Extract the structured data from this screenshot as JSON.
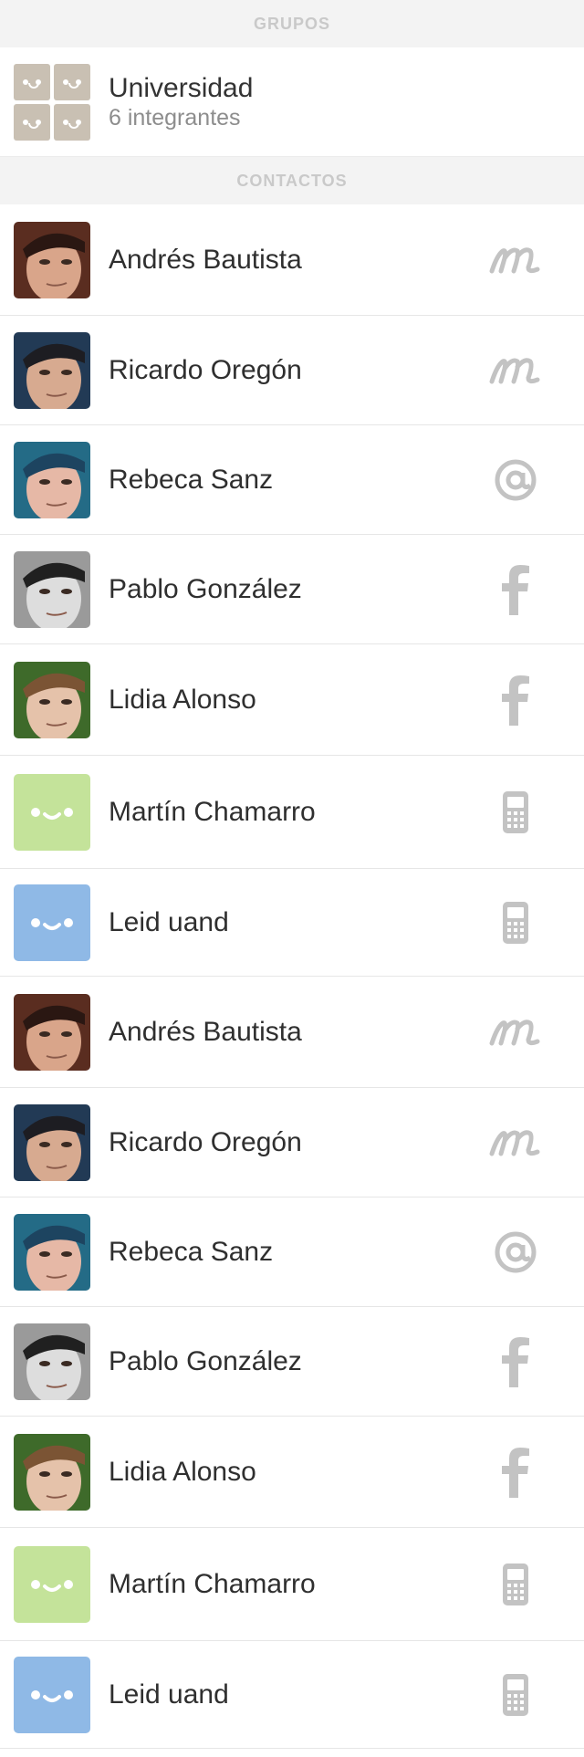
{
  "groups_header": "GRUPOS",
  "group": {
    "name": "Universidad",
    "members": "6 integrantes"
  },
  "contacts_header": "CONTACTOS",
  "contacts": [
    {
      "name": "Andrés Bautista",
      "avatar": "photo-andres",
      "service": "m-service-icon"
    },
    {
      "name": "Ricardo Oregón",
      "avatar": "photo-ricardo",
      "service": "m-service-icon"
    },
    {
      "name": "Rebeca Sanz",
      "avatar": "photo-rebeca",
      "service": "at-email-icon"
    },
    {
      "name": "Pablo González",
      "avatar": "photo-pablo",
      "service": "facebook-icon"
    },
    {
      "name": "Lidia Alonso",
      "avatar": "photo-lidia",
      "service": "facebook-icon"
    },
    {
      "name": "Martín Chamarro",
      "avatar": "placeholder-green",
      "service": "mobile-phone-icon"
    },
    {
      "name": "Leid uand",
      "avatar": "placeholder-blue",
      "service": "mobile-phone-icon"
    },
    {
      "name": "Andrés Bautista",
      "avatar": "photo-andres",
      "service": "m-service-icon"
    },
    {
      "name": "Ricardo Oregón",
      "avatar": "photo-ricardo",
      "service": "m-service-icon"
    },
    {
      "name": "Rebeca Sanz",
      "avatar": "photo-rebeca",
      "service": "at-email-icon"
    },
    {
      "name": "Pablo González",
      "avatar": "photo-pablo",
      "service": "facebook-icon"
    },
    {
      "name": "Lidia Alonso",
      "avatar": "photo-lidia",
      "service": "facebook-icon"
    },
    {
      "name": "Martín Chamarro",
      "avatar": "placeholder-green",
      "service": "mobile-phone-icon"
    },
    {
      "name": "Leid uand",
      "avatar": "placeholder-blue",
      "service": "mobile-phone-icon"
    }
  ],
  "colors": {
    "placeholder_green": "#c4e39a",
    "placeholder_blue": "#8fb9e6",
    "service_icon": "#c3c3c3",
    "header_bg": "#f3f3f3"
  }
}
